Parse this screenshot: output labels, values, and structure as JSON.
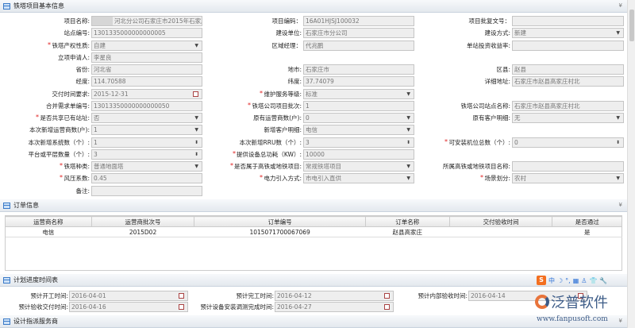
{
  "sections": {
    "basic": "铁塔项目基本信息",
    "order": "订单信息",
    "plan": "计划进度时间表",
    "design": "设计指派服务商"
  },
  "collapse_glyph": "¥",
  "form_rows": [
    [
      {
        "label": "项目名称:",
        "value": "河北分公司石家庄市2015年石家庄",
        "type": "text"
      },
      {
        "label": "项目编码：",
        "value": "16A01HJSJ100032",
        "type": "text"
      },
      {
        "label": "项目批复文号：",
        "value": "",
        "type": "text"
      }
    ],
    [
      {
        "label": "站点编号:",
        "value": "1301335000000000005",
        "type": "text"
      },
      {
        "label": "建设单位:",
        "value": "石家庄市分公司",
        "type": "text"
      },
      {
        "label": "建设方式:",
        "value": "新建",
        "type": "select"
      }
    ],
    [
      {
        "label": "铁塔产权性质:",
        "required": true,
        "value": "自建",
        "type": "select"
      },
      {
        "label": "区域经理：",
        "value": "代兆鹏",
        "type": "text"
      },
      {
        "label": "单站投资收益率:",
        "value": "",
        "type": "text"
      }
    ],
    [
      {
        "label": "立项申请人:",
        "value": "李星良",
        "type": "text"
      },
      null,
      null
    ],
    [
      {
        "label": "省份:",
        "value": "河北省",
        "type": "text"
      },
      {
        "label": "地市:",
        "value": "石家庄市",
        "type": "text"
      },
      {
        "label": "区县:",
        "value": "赵县",
        "type": "text"
      }
    ],
    [
      {
        "label": "经度:",
        "value": "114.70588",
        "type": "text"
      },
      {
        "label": "纬度:",
        "value": "37.74079",
        "type": "text"
      },
      {
        "label": "详细地址:",
        "value": "石家庄市赵县高家庄村北",
        "type": "text"
      }
    ],
    [
      {
        "label": "交付时间要求:",
        "value": "2015-12-31",
        "type": "date"
      },
      {
        "label": "维护服务等级:",
        "required": true,
        "value": "标准",
        "type": "select"
      },
      null
    ],
    [
      {
        "label": "合并需求单编号:",
        "value": "13013350000000000050",
        "type": "text"
      },
      {
        "label": "铁塔公司项目批次:",
        "required": true,
        "value": "1",
        "type": "text"
      },
      {
        "label": "铁塔公司站点名称:",
        "value": "石家庄市赵县高家庄村北",
        "type": "text"
      }
    ],
    [
      {
        "label": "是否共享已有站址:",
        "required": true,
        "value": "否",
        "type": "select"
      },
      {
        "label": "原有运营商数(户):",
        "value": "0",
        "type": "select"
      },
      {
        "label": "原有客户明细:",
        "value": "无",
        "type": "select"
      }
    ],
    [
      {
        "label": "本次新增运营商数(户):",
        "value": "1",
        "type": "select"
      },
      {
        "label": "新增客户明细:",
        "value": "电信",
        "type": "select"
      },
      null
    ],
    [
      {
        "label": "本次新增系统数（个）:",
        "value": "1",
        "type": "spin"
      },
      {
        "label": "本次新增RRU数（个）:",
        "value": "3",
        "type": "spin"
      },
      {
        "label": "可安装机位总数（个）:",
        "required": true,
        "value": "0",
        "type": "spin"
      }
    ],
    [
      {
        "label": "平台或平层数量（个）:",
        "value": "3",
        "type": "spin"
      },
      {
        "label": "提供设备总功耗（KW）:",
        "required": true,
        "value": "10000",
        "type": "text"
      },
      null
    ],
    [
      {
        "label": "铁塔种类:",
        "required": true,
        "value": "普通地面塔",
        "type": "select"
      },
      {
        "label": "是否属于高铁或地铁项目:",
        "required": true,
        "value": "常规铁塔项目",
        "type": "select"
      },
      {
        "label": "所属高铁或地铁项目名称:",
        "value": "",
        "type": "text"
      }
    ],
    [
      {
        "label": "风压系数:",
        "required": true,
        "value": "0.45",
        "type": "text"
      },
      {
        "label": "电力引入方式:",
        "required": true,
        "value": "市电引入直供",
        "type": "select"
      },
      {
        "label": "场景划分:",
        "required": true,
        "value": "农村",
        "type": "select"
      }
    ],
    [
      {
        "label": "备注:",
        "value": "",
        "type": "text"
      },
      null,
      null
    ]
  ],
  "order_table": {
    "headers": [
      "运营商名称",
      "运营商批次号",
      "订单编号",
      "订单名称",
      "交付验收时间",
      "是否通过"
    ],
    "rows": [
      [
        "电信",
        "2015D02",
        "1015071700067069",
        "赵县高家庄",
        "",
        "是"
      ]
    ]
  },
  "plan_rows": [
    [
      {
        "label": "预计开工时间:",
        "value": "2016-04-01"
      },
      {
        "label": "预计完工时间:",
        "value": "2016-04-12"
      },
      {
        "label": "预计内部验收时间:",
        "value": "2016-04-14"
      }
    ],
    [
      {
        "label": "预计验收交付时间:",
        "value": "2016-04-16"
      },
      {
        "label": "预计设备安装调测完成时间:",
        "value": "2016-04-27"
      },
      null
    ]
  ],
  "ime_toolbar": {
    "logo": "S",
    "items": [
      "中",
      "☽",
      "°,",
      "▦",
      "♙",
      "👕",
      "🔧"
    ]
  },
  "watermark": {
    "name": "泛普软件",
    "url": "www.fanpusoft.com"
  }
}
